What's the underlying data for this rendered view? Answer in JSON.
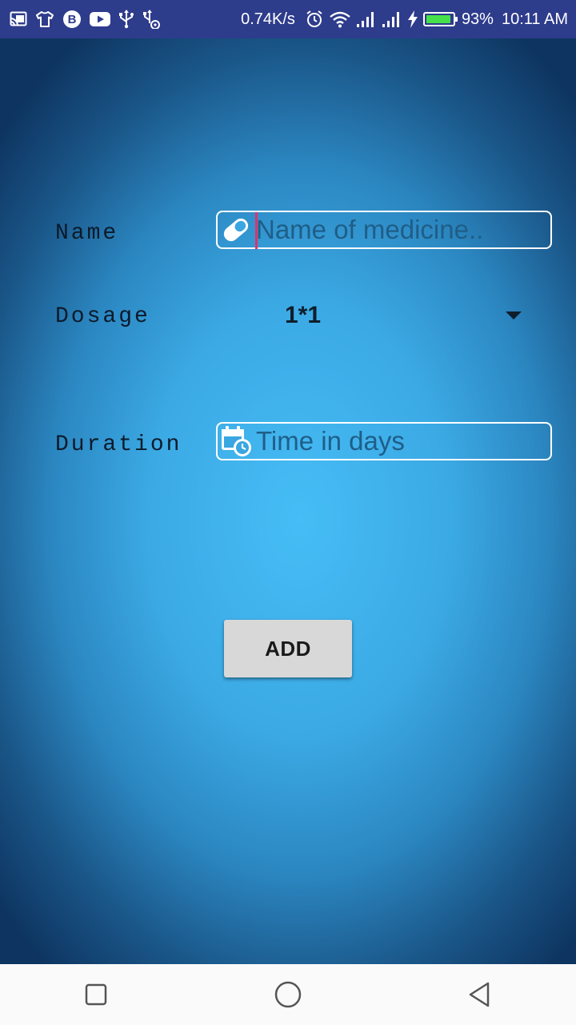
{
  "status_bar": {
    "net_speed": "0.74K/s",
    "battery_percent": "93%",
    "battery_level": 0.93,
    "time": "10:11 AM",
    "icons_left": [
      "cast-icon",
      "tshirt-icon",
      "bitcoin-icon",
      "youtube-icon",
      "usb-icon",
      "usb-debug-icon"
    ],
    "icons_right": [
      "alarm-icon",
      "wifi-icon",
      "signal-icon",
      "signal-icon",
      "charging-icon",
      "battery-icon"
    ]
  },
  "form": {
    "name": {
      "label": "Name",
      "placeholder": "Name of medicine..",
      "value": "",
      "icon": "pill-icon"
    },
    "dosage": {
      "label": "Dosage",
      "selected": "1*1"
    },
    "duration": {
      "label": "Duration",
      "placeholder": "Time in days",
      "value": "",
      "icon": "calendar-clock-icon"
    },
    "add_button_label": "ADD"
  },
  "nav_bar": {
    "buttons": [
      "recents-button",
      "home-button",
      "back-button"
    ]
  },
  "colors": {
    "status_bar_bg": "#2e3c8c",
    "background_center": "#46bdf6",
    "background_edge": "#0e3561",
    "cursor": "#e0336a",
    "battery_fill": "#45e04a"
  }
}
